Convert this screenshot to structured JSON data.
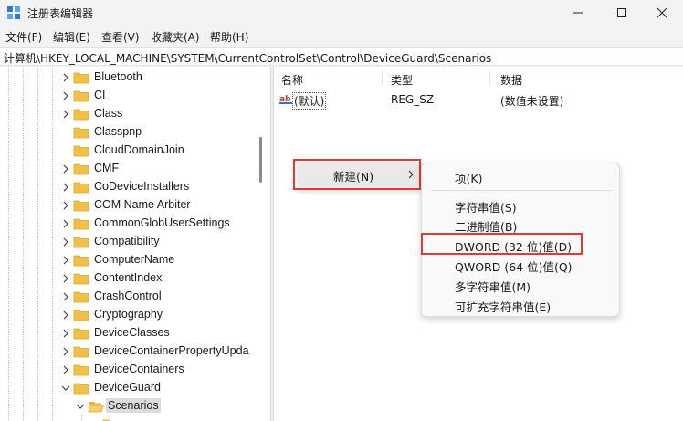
{
  "window": {
    "title": "注册表编辑器",
    "controls": {
      "minimize_icon": "minimize-icon",
      "maximize_icon": "maximize-icon",
      "close_icon": "close-icon"
    }
  },
  "menubar": {
    "items": [
      "文件(F)",
      "编辑(E)",
      "查看(V)",
      "收藏夹(A)",
      "帮助(H)"
    ]
  },
  "address": {
    "path": "计算机\\HKEY_LOCAL_MACHINE\\SYSTEM\\CurrentControlSet\\Control\\DeviceGuard\\Scenarios"
  },
  "tree": {
    "items": [
      {
        "label": "Bluetooth",
        "expanded": false
      },
      {
        "label": "CI",
        "expanded": false
      },
      {
        "label": "Class",
        "expanded": false
      },
      {
        "label": "Classpnp",
        "expanded": false
      },
      {
        "label": "CloudDomainJoin",
        "expanded": false
      },
      {
        "label": "CMF",
        "expanded": false
      },
      {
        "label": "CoDeviceInstallers",
        "expanded": false
      },
      {
        "label": "COM Name Arbiter",
        "expanded": false
      },
      {
        "label": "CommonGlobUserSettings",
        "expanded": false
      },
      {
        "label": "Compatibility",
        "expanded": false
      },
      {
        "label": "ComputerName",
        "expanded": false
      },
      {
        "label": "ContentIndex",
        "expanded": false
      },
      {
        "label": "CrashControl",
        "expanded": false
      },
      {
        "label": "Cryptography",
        "expanded": false
      },
      {
        "label": "DeviceClasses",
        "expanded": false
      },
      {
        "label": "DeviceContainerPropertyUpda",
        "expanded": false
      },
      {
        "label": "DeviceContainers",
        "expanded": false
      },
      {
        "label": "DeviceGuard",
        "expanded": true
      },
      {
        "label": "Scenarios",
        "expanded": true,
        "selected": true
      }
    ]
  },
  "list": {
    "columns": [
      "名称",
      "类型",
      "数据"
    ],
    "rows": [
      {
        "name": "(默认)",
        "type": "REG_SZ",
        "data": "(数值未设置)",
        "icon": "reg-string-icon"
      }
    ]
  },
  "context_menu": {
    "new_label": "新建(N)",
    "submenu": {
      "key_item": "项(K)",
      "items": [
        "字符串值(S)",
        "二进制值(B)",
        "DWORD (32 位)值(D)",
        "QWORD (64 位)值(Q)",
        "多字符串值(M)",
        "可扩充字符串值(E)"
      ]
    }
  },
  "colors": {
    "highlight_box": "#e53935",
    "folder": "#f2c046",
    "selection": "#dcdcdc"
  }
}
